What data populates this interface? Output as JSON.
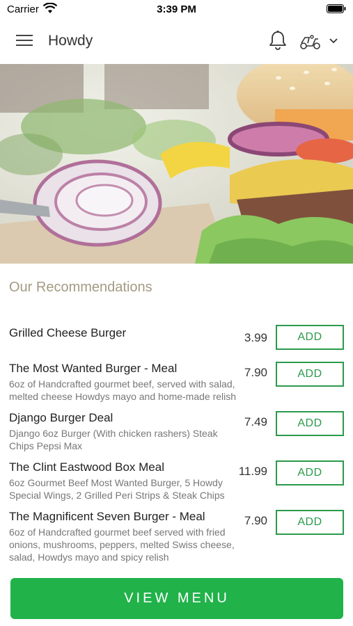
{
  "status_bar": {
    "carrier": "Carrier",
    "time": "3:39 PM"
  },
  "navbar": {
    "title": "Howdy",
    "icons": [
      "menu-icon",
      "bell-icon",
      "scooter-icon",
      "chevron-down-icon"
    ]
  },
  "section_title": "Our Recommendations",
  "items": [
    {
      "name": "Grilled Cheese Burger",
      "description": "",
      "price": "3.99",
      "button": "ADD"
    },
    {
      "name": "The Most Wanted Burger - Meal",
      "description": "6oz of Handcrafted gourmet beef, served with salad, melted cheese Howdys mayo and home-made relish",
      "price": "7.90",
      "button": "ADD"
    },
    {
      "name": "Django Burger Deal",
      "description": "Django 6oz Burger (With chicken rashers)  Steak Chips  Pepsi Max",
      "price": "7.49",
      "button": "ADD"
    },
    {
      "name": "The Clint Eastwood Box Meal",
      "description": "6oz Gourmet Beef Most Wanted Burger, 5 Howdy Special Wings, 2 Grilled Peri Strips & Steak Chips",
      "price": "11.99",
      "button": "ADD"
    },
    {
      "name": "The Magnificent Seven Burger - Meal",
      "description": "6oz of Handcrafted gourmet beef served with fried onions, mushrooms, peppers, melted Swiss cheese, salad, Howdys mayo and spicy relish",
      "price": "7.90",
      "button": "ADD"
    }
  ],
  "footer": {
    "view_menu_label": "VIEW MENU"
  },
  "colors": {
    "accent_green": "#21b24a",
    "add_border": "#2a9a4b",
    "section_title": "#a49a83"
  }
}
